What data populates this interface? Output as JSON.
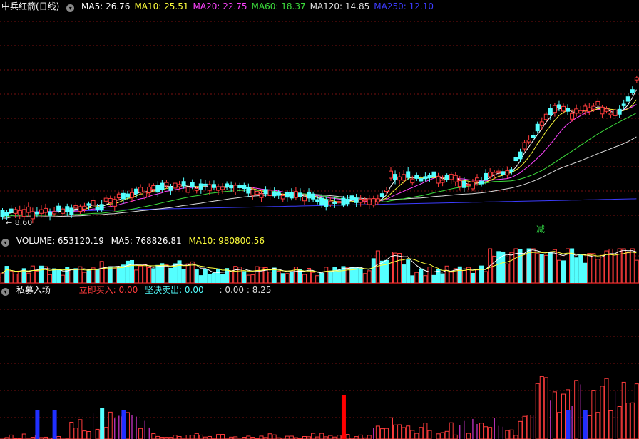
{
  "price_panel": {
    "title": "中兵红箭(日线)",
    "ma": [
      {
        "label": "MA5: 26.76",
        "color": "#ffffff"
      },
      {
        "label": "MA10: 25.51",
        "color": "#ffff3c"
      },
      {
        "label": "MA20: 22.75",
        "color": "#ff44ff"
      },
      {
        "label": "MA60: 18.37",
        "color": "#3cdc3c"
      },
      {
        "label": "MA120: 14.85",
        "color": "#dddddd"
      },
      {
        "label": "MA250: 12.10",
        "color": "#3c3cff"
      }
    ],
    "low_label": "8.60",
    "signal_label": "减"
  },
  "volume_panel": {
    "title": "VOLUME: 653120.19",
    "ma5": "MA5: 768826.81",
    "ma10": "MA10: 980800.56"
  },
  "indicator_panel": {
    "title": "私募入场",
    "buy": "立即买入: 0.00",
    "sell": "坚决卖出: 0.00",
    "extra": ": 0.00  : 8.25"
  },
  "colors": {
    "up": "#ff3c3c",
    "down": "#54ffff",
    "ma5": "#ffffff",
    "ma10": "#ffff3c",
    "ma20": "#ff44ff",
    "ma60": "#3cdc3c",
    "ma120": "#dddddd",
    "ma250": "#3c3cff",
    "grid": "#7a1010"
  }
}
